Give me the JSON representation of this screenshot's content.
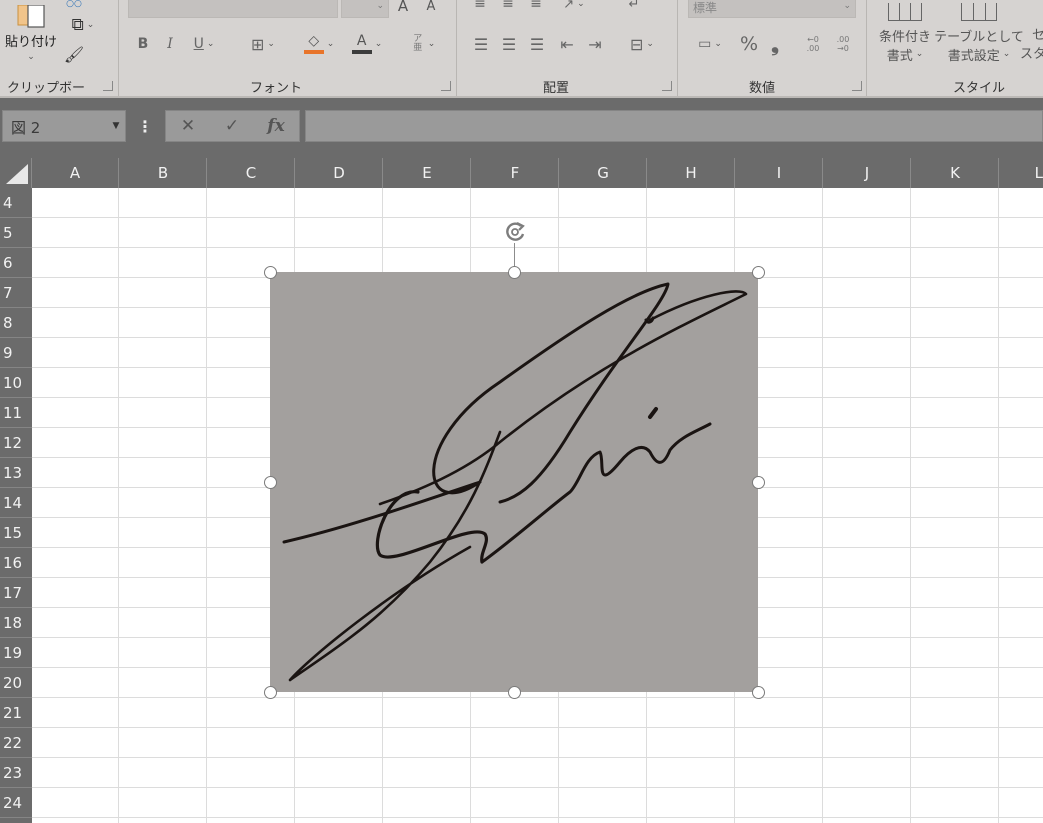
{
  "ribbon": {
    "clipboard": {
      "paste_label": "貼り付け",
      "group_label": "クリップボード"
    },
    "font": {
      "bold": "B",
      "italic": "I",
      "underline": "U",
      "grow": "A",
      "shrink": "A",
      "font_color_letter": "A",
      "phonetic": "ア亜",
      "group_label": "フォント"
    },
    "alignment": {
      "group_label": "配置"
    },
    "number": {
      "format_value": "標準",
      "percent": "%",
      "comma": "❟",
      "inc_decimal": "←0 .00",
      "dec_decimal": ".00 →0",
      "group_label": "数値"
    },
    "styles": {
      "conditional_label_1": "条件付き",
      "conditional_label_2": "書式",
      "table_label_1": "テーブルとして",
      "table_label_2": "書式設定",
      "cell_style_1": "セ",
      "cell_style_2": "スタ",
      "group_label": "スタイル"
    }
  },
  "formula_bar": {
    "name_box": "図 2",
    "cancel": "✕",
    "enter": "✓",
    "fx": "fx",
    "content": ""
  },
  "grid": {
    "columns": [
      "A",
      "B",
      "C",
      "D",
      "E",
      "F",
      "G",
      "H",
      "I",
      "J",
      "K",
      "L"
    ],
    "rows": [
      "4",
      "5",
      "6",
      "7",
      "8",
      "9",
      "10",
      "11",
      "12",
      "13",
      "14",
      "15",
      "16",
      "17",
      "18",
      "19",
      "20",
      "21",
      "22",
      "23",
      "24"
    ]
  },
  "picture": {
    "name": "図 2",
    "content": "handwritten signature",
    "background_color": "#a3a09e",
    "ink_color": "#1a1412"
  },
  "colors": {
    "ribbon_bg": "#d6d3d1",
    "header_bg": "#6b6b6b",
    "gridline": "#dcdcdc"
  }
}
